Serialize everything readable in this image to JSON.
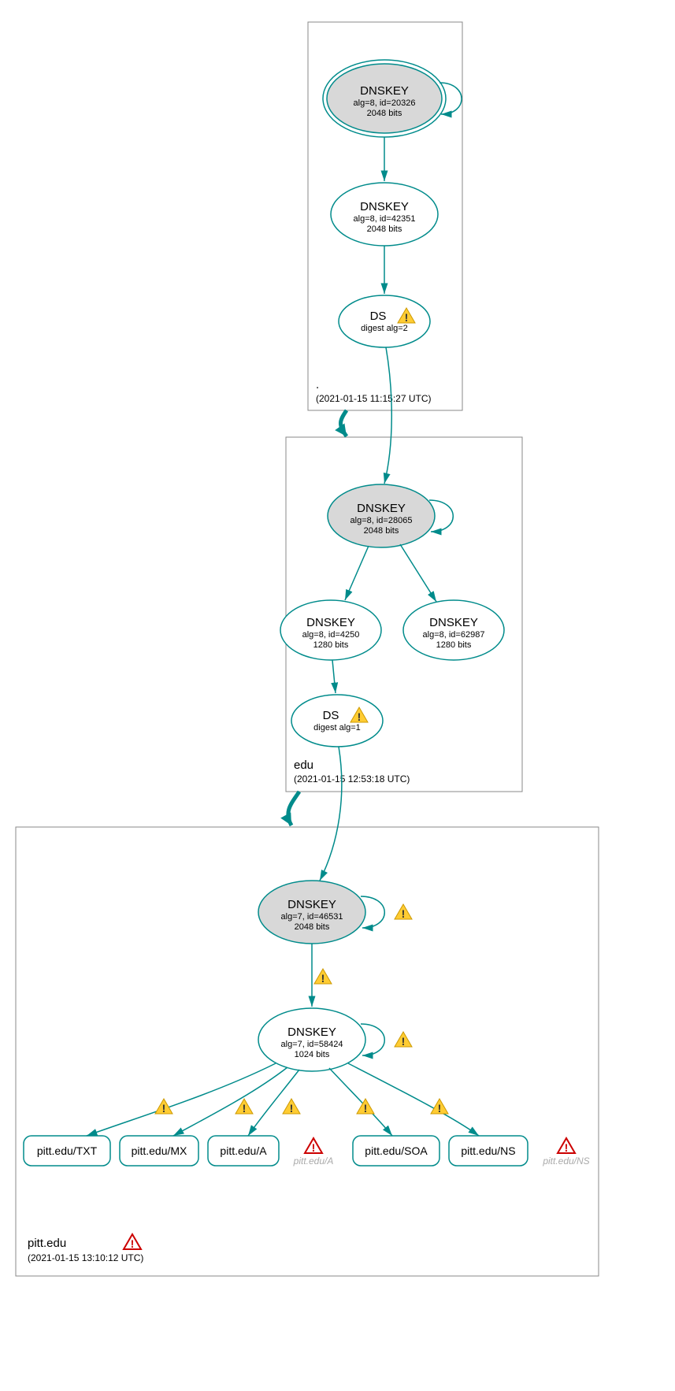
{
  "zones": {
    "root": {
      "label": ".",
      "timestamp": "(2021-01-15 11:15:27 UTC)",
      "nodes": {
        "ksk": {
          "title": "DNSKEY",
          "line1": "alg=8, id=20326",
          "line2": "2048 bits"
        },
        "zsk": {
          "title": "DNSKEY",
          "line1": "alg=8, id=42351",
          "line2": "2048 bits"
        },
        "ds": {
          "title": "DS",
          "line1": "digest alg=2"
        }
      }
    },
    "edu": {
      "label": "edu",
      "timestamp": "(2021-01-15 12:53:18 UTC)",
      "nodes": {
        "ksk": {
          "title": "DNSKEY",
          "line1": "alg=8, id=28065",
          "line2": "2048 bits"
        },
        "zsk1": {
          "title": "DNSKEY",
          "line1": "alg=8, id=4250",
          "line2": "1280 bits"
        },
        "zsk2": {
          "title": "DNSKEY",
          "line1": "alg=8, id=62987",
          "line2": "1280 bits"
        },
        "ds": {
          "title": "DS",
          "line1": "digest alg=1"
        }
      }
    },
    "pitt": {
      "label": "pitt.edu",
      "timestamp": "(2021-01-15 13:10:12 UTC)",
      "nodes": {
        "ksk": {
          "title": "DNSKEY",
          "line1": "alg=7, id=46531",
          "line2": "2048 bits"
        },
        "zsk": {
          "title": "DNSKEY",
          "line1": "alg=7, id=58424",
          "line2": "1024 bits"
        }
      },
      "records": {
        "txt": "pitt.edu/TXT",
        "mx": "pitt.edu/MX",
        "a": "pitt.edu/A",
        "soa": "pitt.edu/SOA",
        "ns": "pitt.edu/NS"
      },
      "ghosts": {
        "a": "pitt.edu/A",
        "ns": "pitt.edu/NS"
      }
    }
  }
}
